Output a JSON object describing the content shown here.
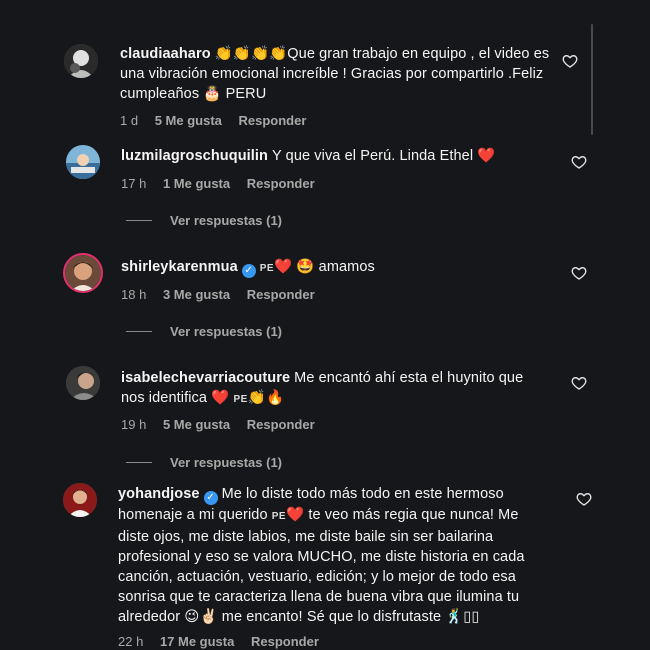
{
  "comments": [
    {
      "username": "claudiaaharo",
      "text": "👏👏👏👏Que gran trabajo en equipo , el video es una vibración emocional increíble ! Gracias por compartirlo .Feliz cumpleaños 🎂 PERU",
      "time": "1 d",
      "likes": "5 Me gusta",
      "reply": "Responder",
      "avatar_icon": "avatar-claudiaaharo"
    },
    {
      "username": "luzmilagroschuquilin",
      "text": "Y que viva el Perú. Linda Ethel ❤️",
      "time": "17 h",
      "likes": "1 Me gusta",
      "reply": "Responder",
      "replies": "Ver respuestas (1)",
      "avatar_icon": "avatar-luzmilagroschuquilin"
    },
    {
      "username": "shirleykarenmua",
      "flag": "PE",
      "text": "❤️ 🤩 amamos",
      "time": "18 h",
      "likes": "3 Me gusta",
      "reply": "Responder",
      "replies": "Ver respuestas (1)",
      "avatar_icon": "avatar-shirleykarenmua"
    },
    {
      "username": "isabelechevarriacouture",
      "text_a": "Me encantó ahí esta el huynito que nos identifica ❤️",
      "flag": "PE",
      "text_b": "👏🔥",
      "time": "19 h",
      "likes": "5 Me gusta",
      "reply": "Responder",
      "replies": "Ver respuestas (1)",
      "avatar_icon": "avatar-isabelechevarriacouture"
    },
    {
      "username": "yohandjose",
      "text_a": "Me lo diste todo más todo en este hermoso homenaje a mi querido",
      "flag": "PE",
      "text_b": "❤️ te veo más regia que nunca! Me diste ojos, me diste labios, me diste baile sin ser bailarina profesional y eso se valora MUCHO, me diste historia en cada canción, actuación, vestuario, edición; y lo mejor de todo esa sonrisa que te caracteriza llena de buena vibra que ilumina tu alrededor 😉✌🏻 me encanto! Sé que lo disfrutaste 🕺▯▯",
      "time": "22 h",
      "likes": "17 Me gusta",
      "reply": "Responder",
      "avatar_icon": "avatar-yohandjose"
    }
  ],
  "colors": {
    "background": "#16171a",
    "text": "#f5f5f5",
    "secondary": "#a8a8a8",
    "verified": "#3897f0",
    "story_ring": "#e1306c"
  }
}
